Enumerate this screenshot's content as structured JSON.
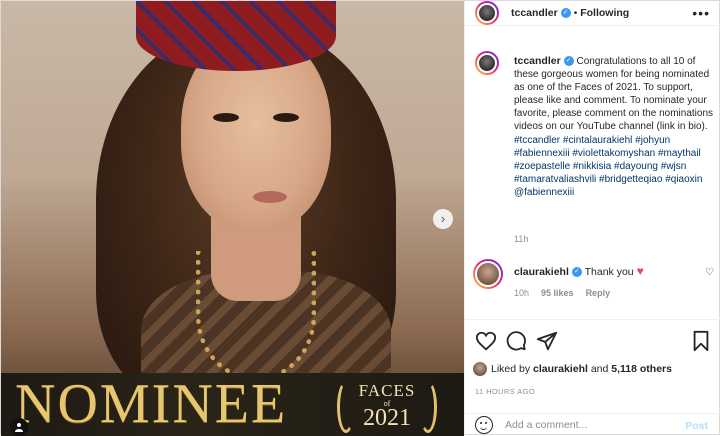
{
  "header": {
    "username": "tccandler",
    "separator": "•",
    "follow_status": "Following",
    "more_icon": "ellipsis-icon"
  },
  "post_image": {
    "banner_text": "NOMINEE",
    "badge_title": "FACES",
    "badge_of": "of",
    "badge_year": "2021",
    "next_icon": "chevron-right-icon",
    "tag_icon": "user-tag-icon"
  },
  "caption": {
    "username": "tccandler",
    "text_1": "Congratulations to all 10 of these gorgeous women for being nominated as one of the Faces of 2021. To support, please like and comment.  To nominate your favorite,  please comment on the nominations videos on our YouTube channel (link in bio).",
    "hashtags": "#tccandler #cintalaurakiehl #johyun #fabiennexiii #violettakomyshan #maythail #zoepastelle #nikkisia #dayoung #wjsn #tamaratvaliashvili #bridgetteqiao #qiaoxin",
    "mention": "@fabiennexiii",
    "time": "11h"
  },
  "comment": {
    "username": "claurakiehl",
    "text": "Thank you",
    "time": "10h",
    "likes": "95 likes",
    "reply": "Reply"
  },
  "actions": {
    "like_icon": "heart-icon",
    "comment_icon": "comment-icon",
    "share_icon": "send-icon",
    "save_icon": "bookmark-icon"
  },
  "likes": {
    "prefix": "Liked by",
    "user": "claurakiehl",
    "and": "and",
    "others": "5,118 others"
  },
  "posted_ago": "11 HOURS AGO",
  "add_comment": {
    "placeholder": "Add a comment...",
    "post_label": "Post"
  },
  "colors": {
    "verified": "#3897f0",
    "hashtag": "#00376b",
    "heart": "#ed4956",
    "post_button": "#b2dffc"
  }
}
